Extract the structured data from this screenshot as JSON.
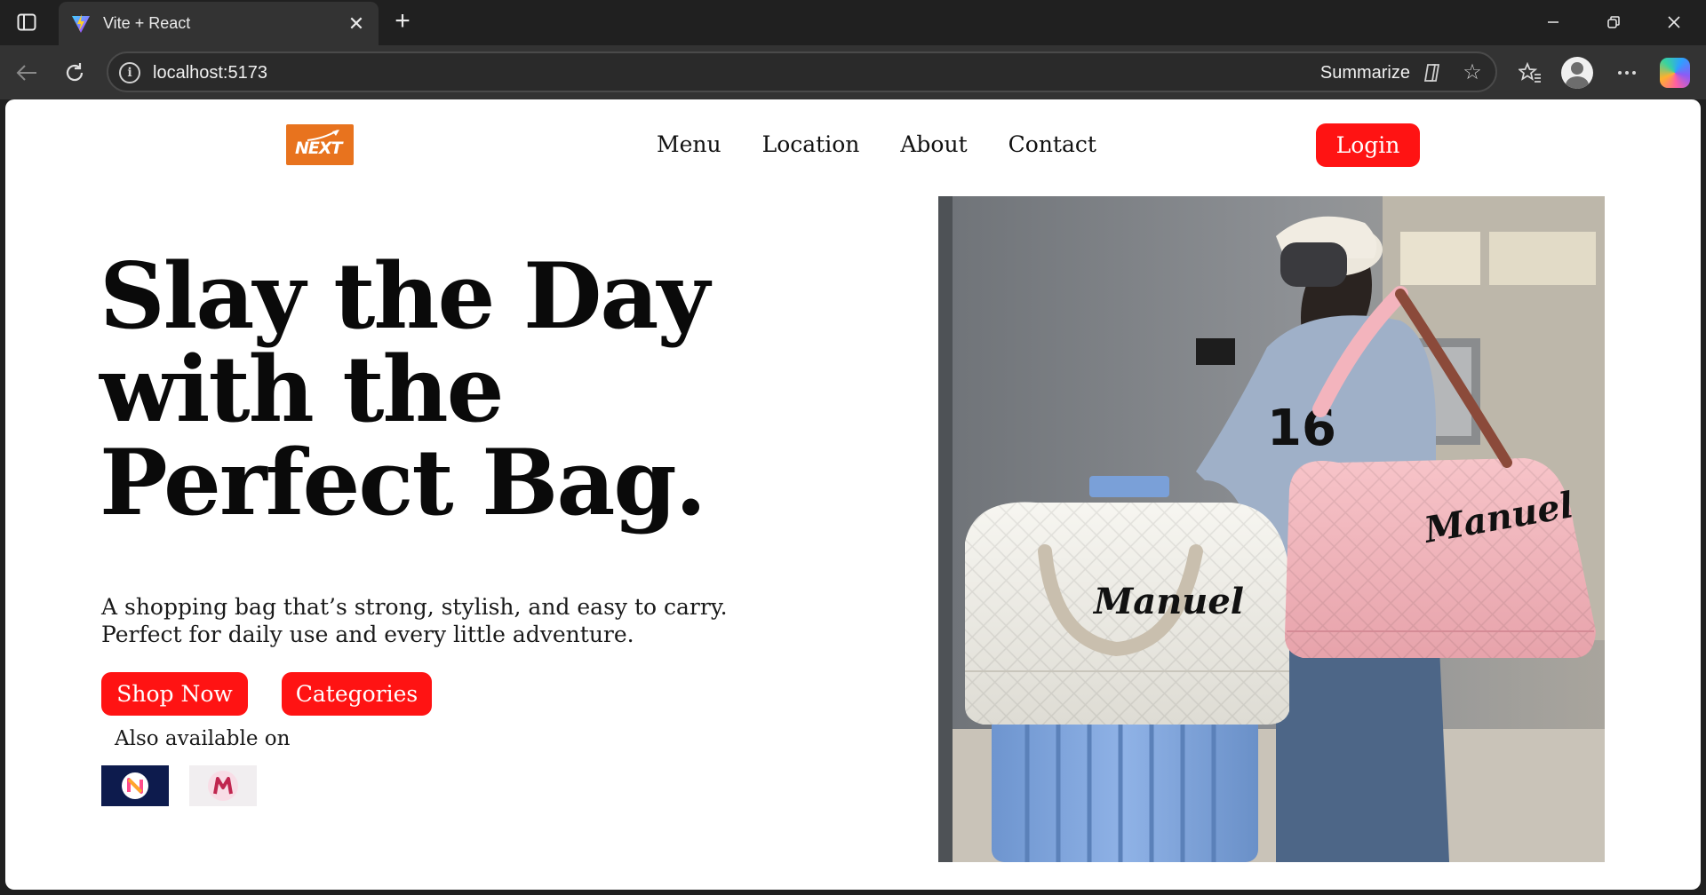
{
  "browser": {
    "tab_title": "Vite + React",
    "url": "localhost:5173",
    "summarize_label": "Summarize"
  },
  "site": {
    "nav": [
      "Menu",
      "Location",
      "About",
      "Contact"
    ],
    "login_label": "Login",
    "hero": {
      "heading_lines": [
        "Slay the Day",
        "with the",
        "Perfect Bag."
      ],
      "subtext": "A shopping bag that’s strong, stylish, and easy to carry. Perfect for daily use and every little adventure.",
      "primary_cta": "Shop Now",
      "secondary_cta": "Categories",
      "also_available": "Also available on"
    },
    "photo_bag_labels": {
      "left_bag": "Manuel",
      "right_bag": "Manuel"
    },
    "jersey_number": "16",
    "colors": {
      "accent": "#ff1313",
      "logo_orange": "#e8731e",
      "store_badge_navy": "#0d1b4d"
    }
  }
}
